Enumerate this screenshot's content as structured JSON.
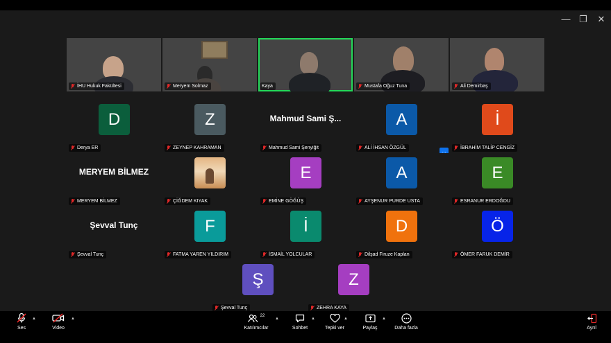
{
  "videos": [
    {
      "name": "İHU Hukuk Fakültesi"
    },
    {
      "name": "Meryem Solmaz"
    },
    {
      "name": "Kaya"
    },
    {
      "name": "Mustafa Oğuz Tuna"
    },
    {
      "name": "Ali Demirbaş"
    }
  ],
  "participants": [
    {
      "letter": "D",
      "name": "Derya ER",
      "color": "#0b5e3c"
    },
    {
      "letter": "Z",
      "name": "ZEYNEP KAHRAMAN",
      "color": "#4a5a60"
    },
    {
      "bigname": "Mahmud Sami Ş...",
      "name": "Mahmud Sami Şenyiğit"
    },
    {
      "letter": "A",
      "name": "ALİ İHSAN ÖZGÜL",
      "color": "#0b59a8"
    },
    {
      "letter": "İ",
      "name": "İBRAHİM TALİP CENGİZ",
      "color": "#e04a1b"
    },
    {
      "bigname": "MERYEM BİLMEZ",
      "name": "MERYEM BİLMEZ"
    },
    {
      "name": "ÇİĞDEM KIYAK"
    },
    {
      "letter": "E",
      "name": "EMİNE GÖĞÜŞ",
      "color": "#a53ec1"
    },
    {
      "letter": "A",
      "name": "AYŞENUR PURDE USTA",
      "color": "#0b59a8"
    },
    {
      "letter": "E",
      "name": "ESRANUR ERDOĞDU",
      "color": "#3a8a26"
    },
    {
      "bigname": "Şevval Tunç",
      "name": "Şevval Tunç"
    },
    {
      "letter": "F",
      "name": "FATMA YAREN YILDIRIM",
      "color": "#0a9b9a"
    },
    {
      "letter": "İ",
      "name": "İSMAİL YOLCULAR",
      "color": "#0a8a6e"
    },
    {
      "letter": "D",
      "name": "Dilşad Firuze Kaplan",
      "color": "#f0720d"
    },
    {
      "letter": "Ö",
      "name": "ÖMER FARUK DEMİR",
      "color": "#0724e8"
    },
    {
      "letter": "Ş",
      "name": "Şevval Tunç",
      "color": "#5f4fbf"
    },
    {
      "letter": "Z",
      "name": "ZEHRA KAYA",
      "color": "#a53ec1"
    }
  ],
  "more_button": "...",
  "toolbar": {
    "audio": "Ses",
    "video": "Video",
    "participants": "Katılımcılar",
    "participant_count": "22",
    "chat": "Sohbet",
    "reactions": "Tepki ver",
    "share": "Paylaş",
    "more": "Daha fazla",
    "leave": "Ayrıl"
  },
  "colors": {
    "accent": "#23d959",
    "leave": "#e02828",
    "tile_bg": "#1a1a1a"
  }
}
